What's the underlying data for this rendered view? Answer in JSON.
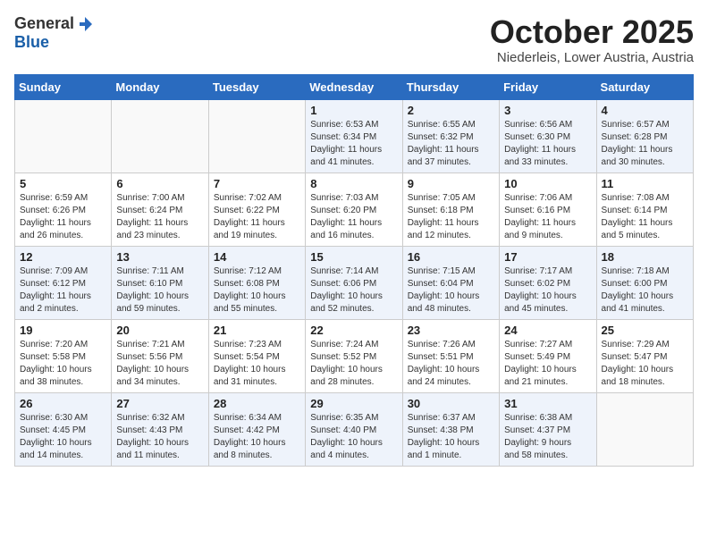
{
  "header": {
    "logo_general": "General",
    "logo_blue": "Blue",
    "month_title": "October 2025",
    "location": "Niederleis, Lower Austria, Austria"
  },
  "weekdays": [
    "Sunday",
    "Monday",
    "Tuesday",
    "Wednesday",
    "Thursday",
    "Friday",
    "Saturday"
  ],
  "weeks": [
    [
      {
        "day": "",
        "info": ""
      },
      {
        "day": "",
        "info": ""
      },
      {
        "day": "",
        "info": ""
      },
      {
        "day": "1",
        "info": "Sunrise: 6:53 AM\nSunset: 6:34 PM\nDaylight: 11 hours\nand 41 minutes."
      },
      {
        "day": "2",
        "info": "Sunrise: 6:55 AM\nSunset: 6:32 PM\nDaylight: 11 hours\nand 37 minutes."
      },
      {
        "day": "3",
        "info": "Sunrise: 6:56 AM\nSunset: 6:30 PM\nDaylight: 11 hours\nand 33 minutes."
      },
      {
        "day": "4",
        "info": "Sunrise: 6:57 AM\nSunset: 6:28 PM\nDaylight: 11 hours\nand 30 minutes."
      }
    ],
    [
      {
        "day": "5",
        "info": "Sunrise: 6:59 AM\nSunset: 6:26 PM\nDaylight: 11 hours\nand 26 minutes."
      },
      {
        "day": "6",
        "info": "Sunrise: 7:00 AM\nSunset: 6:24 PM\nDaylight: 11 hours\nand 23 minutes."
      },
      {
        "day": "7",
        "info": "Sunrise: 7:02 AM\nSunset: 6:22 PM\nDaylight: 11 hours\nand 19 minutes."
      },
      {
        "day": "8",
        "info": "Sunrise: 7:03 AM\nSunset: 6:20 PM\nDaylight: 11 hours\nand 16 minutes."
      },
      {
        "day": "9",
        "info": "Sunrise: 7:05 AM\nSunset: 6:18 PM\nDaylight: 11 hours\nand 12 minutes."
      },
      {
        "day": "10",
        "info": "Sunrise: 7:06 AM\nSunset: 6:16 PM\nDaylight: 11 hours\nand 9 minutes."
      },
      {
        "day": "11",
        "info": "Sunrise: 7:08 AM\nSunset: 6:14 PM\nDaylight: 11 hours\nand 5 minutes."
      }
    ],
    [
      {
        "day": "12",
        "info": "Sunrise: 7:09 AM\nSunset: 6:12 PM\nDaylight: 11 hours\nand 2 minutes."
      },
      {
        "day": "13",
        "info": "Sunrise: 7:11 AM\nSunset: 6:10 PM\nDaylight: 10 hours\nand 59 minutes."
      },
      {
        "day": "14",
        "info": "Sunrise: 7:12 AM\nSunset: 6:08 PM\nDaylight: 10 hours\nand 55 minutes."
      },
      {
        "day": "15",
        "info": "Sunrise: 7:14 AM\nSunset: 6:06 PM\nDaylight: 10 hours\nand 52 minutes."
      },
      {
        "day": "16",
        "info": "Sunrise: 7:15 AM\nSunset: 6:04 PM\nDaylight: 10 hours\nand 48 minutes."
      },
      {
        "day": "17",
        "info": "Sunrise: 7:17 AM\nSunset: 6:02 PM\nDaylight: 10 hours\nand 45 minutes."
      },
      {
        "day": "18",
        "info": "Sunrise: 7:18 AM\nSunset: 6:00 PM\nDaylight: 10 hours\nand 41 minutes."
      }
    ],
    [
      {
        "day": "19",
        "info": "Sunrise: 7:20 AM\nSunset: 5:58 PM\nDaylight: 10 hours\nand 38 minutes."
      },
      {
        "day": "20",
        "info": "Sunrise: 7:21 AM\nSunset: 5:56 PM\nDaylight: 10 hours\nand 34 minutes."
      },
      {
        "day": "21",
        "info": "Sunrise: 7:23 AM\nSunset: 5:54 PM\nDaylight: 10 hours\nand 31 minutes."
      },
      {
        "day": "22",
        "info": "Sunrise: 7:24 AM\nSunset: 5:52 PM\nDaylight: 10 hours\nand 28 minutes."
      },
      {
        "day": "23",
        "info": "Sunrise: 7:26 AM\nSunset: 5:51 PM\nDaylight: 10 hours\nand 24 minutes."
      },
      {
        "day": "24",
        "info": "Sunrise: 7:27 AM\nSunset: 5:49 PM\nDaylight: 10 hours\nand 21 minutes."
      },
      {
        "day": "25",
        "info": "Sunrise: 7:29 AM\nSunset: 5:47 PM\nDaylight: 10 hours\nand 18 minutes."
      }
    ],
    [
      {
        "day": "26",
        "info": "Sunrise: 6:30 AM\nSunset: 4:45 PM\nDaylight: 10 hours\nand 14 minutes."
      },
      {
        "day": "27",
        "info": "Sunrise: 6:32 AM\nSunset: 4:43 PM\nDaylight: 10 hours\nand 11 minutes."
      },
      {
        "day": "28",
        "info": "Sunrise: 6:34 AM\nSunset: 4:42 PM\nDaylight: 10 hours\nand 8 minutes."
      },
      {
        "day": "29",
        "info": "Sunrise: 6:35 AM\nSunset: 4:40 PM\nDaylight: 10 hours\nand 4 minutes."
      },
      {
        "day": "30",
        "info": "Sunrise: 6:37 AM\nSunset: 4:38 PM\nDaylight: 10 hours\nand 1 minute."
      },
      {
        "day": "31",
        "info": "Sunrise: 6:38 AM\nSunset: 4:37 PM\nDaylight: 9 hours\nand 58 minutes."
      },
      {
        "day": "",
        "info": ""
      }
    ]
  ]
}
